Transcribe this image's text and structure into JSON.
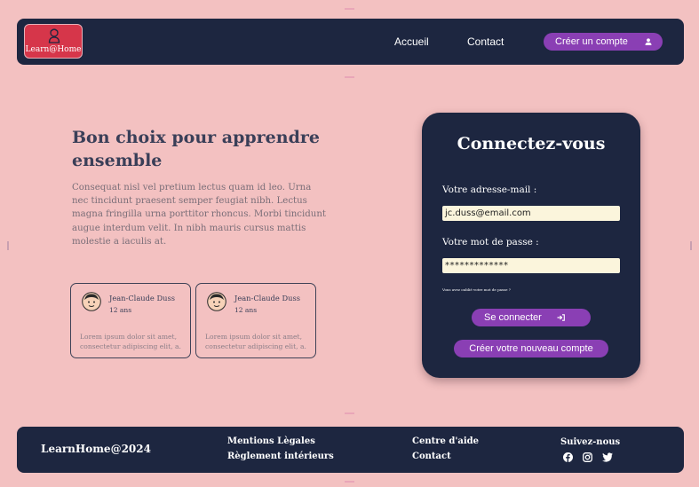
{
  "header": {
    "logo_text": "Learn@Home",
    "nav": {
      "home": "Accueil",
      "contact": "Contact"
    },
    "create_account_label": "Créer un compte"
  },
  "hero": {
    "title": "Bon choix pour apprendre ensemble",
    "text": "Consequat nisl vel pretium lectus quam id leo. Urna nec tincidunt praesent semper feugiat nibh. Lectus magna fringilla urna porttitor rhoncus. Morbi tincidunt augue interdum velit. In nibh mauris cursus mattis molestie a iaculis at."
  },
  "testimonials": [
    {
      "name": "Jean-Claude Duss",
      "age": "12 ans",
      "text_line1": "Lorem ipsum dolor sit amet,",
      "text_line2": "consectetur adipiscing elit, a."
    },
    {
      "name": "Jean-Claude Duss",
      "age": "12 ans",
      "text_line1": "Lorem ipsum dolor sit amet,",
      "text_line2": "consectetur adipiscing elit, a."
    }
  ],
  "login": {
    "title": "Connectez-vous",
    "email_label": "Votre adresse-mail :",
    "email_value": "jc.duss@email.com",
    "password_label": "Votre mot de passe :",
    "password_value": "*************",
    "forgot_text": "Vous avez oublié votre mot de passe ?",
    "submit_label": "Se connecter",
    "new_account_label": "Créer votre nouveau compte"
  },
  "footer": {
    "brand": "LearnHome@2024",
    "links_col1": [
      "Mentions Lègales",
      "Règlement intérieurs"
    ],
    "links_col2": [
      "Centre d'aide",
      "Contact"
    ],
    "follow_label": "Suivez-nous",
    "social_icons": [
      "facebook-icon",
      "instagram-icon",
      "twitter-icon"
    ]
  },
  "colors": {
    "background": "#f3c1c1",
    "navy": "#1d2640",
    "accent_purple": "#8a3fb4",
    "logo_red": "#d6364a",
    "input_bg": "#fbf5dc"
  }
}
